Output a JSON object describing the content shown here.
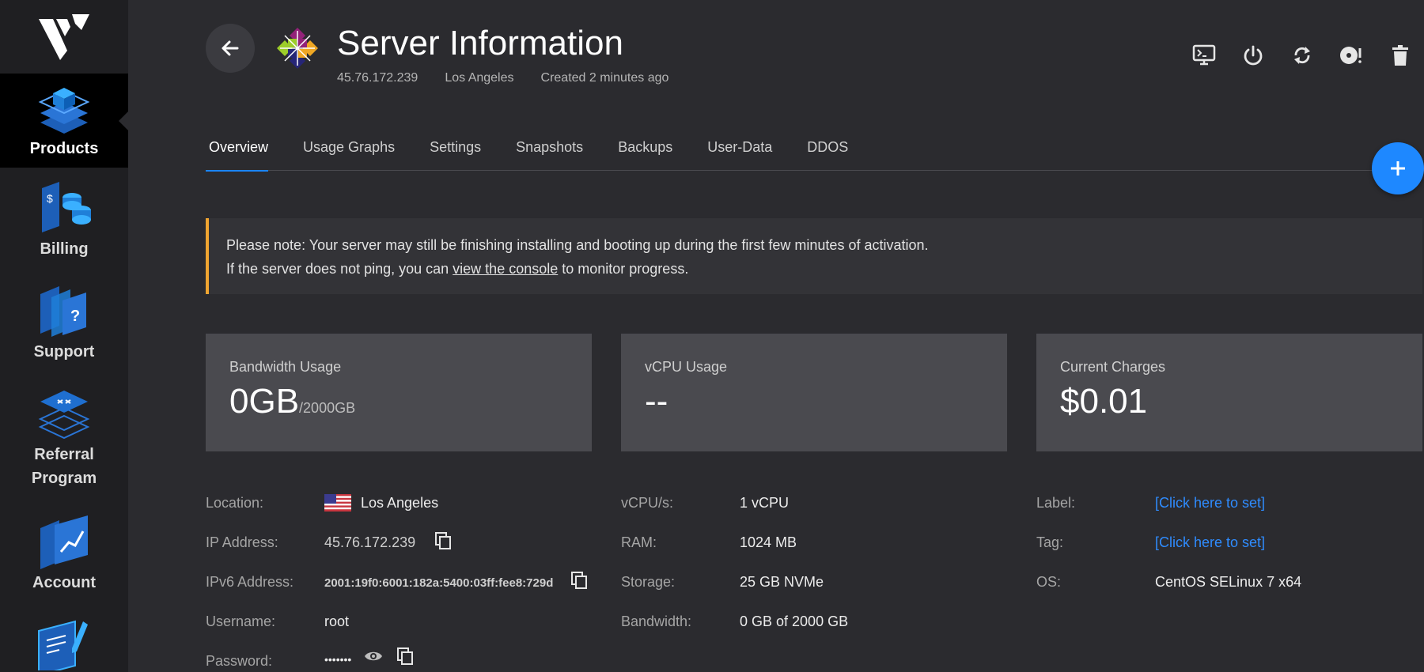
{
  "sidebar": {
    "logo": "vultr-logo",
    "items": [
      {
        "label": "Products",
        "icon": "products-icon",
        "active": true
      },
      {
        "label": "Billing",
        "icon": "billing-icon"
      },
      {
        "label": "Support",
        "icon": "support-icon"
      },
      {
        "label": "Referral Program",
        "icon": "referral-icon"
      },
      {
        "label": "Account",
        "icon": "account-icon"
      },
      {
        "label": "",
        "icon": "documentation-icon"
      }
    ]
  },
  "header": {
    "title": "Server Information",
    "ip": "45.76.172.239",
    "location": "Los Angeles",
    "created": "Created 2 minutes ago",
    "actions": [
      "console-icon",
      "power-icon",
      "restart-icon",
      "reinstall-icon",
      "delete-icon"
    ]
  },
  "tabs": [
    "Overview",
    "Usage Graphs",
    "Settings",
    "Snapshots",
    "Backups",
    "User-Data",
    "DDOS"
  ],
  "notice": {
    "line1": "Please note: Your server may still be finishing installing and booting up during the first few minutes of activation.",
    "line2_before": "If the server does not ping, you can ",
    "line2_link": "view the console",
    "line2_after": " to monitor progress.",
    "accent_color": "#f0a531"
  },
  "cards": {
    "bandwidth": {
      "title": "Bandwidth Usage",
      "value": "0GB",
      "sub": "/2000GB"
    },
    "vcpu": {
      "title": "vCPU Usage",
      "value": "--"
    },
    "charges": {
      "title": "Current Charges",
      "value": "$0.01"
    }
  },
  "info": {
    "location_label": "Location:",
    "location_value": "Los Angeles",
    "ip_label": "IP Address:",
    "ip_value": "45.76.172.239",
    "ipv6_label": "IPv6 Address:",
    "ipv6_value": "2001:19f0:6001:182a:5400:03ff:fee8:729d",
    "username_label": "Username:",
    "username_value": "root",
    "password_label": "Password:",
    "password_value": "•••••••",
    "vcpus_label": "vCPU/s:",
    "vcpus_value": "1 vCPU",
    "ram_label": "RAM:",
    "ram_value": "1024 MB",
    "storage_label": "Storage:",
    "storage_value": "25 GB NVMe",
    "bandwidth_label": "Bandwidth:",
    "bandwidth_value": "0 GB of 2000 GB",
    "label_label": "Label:",
    "label_value": "[Click here to set]",
    "tag_label": "Tag:",
    "tag_value": "[Click here to set]",
    "os_label": "OS:",
    "os_value": "CentOS SELinux 7 x64"
  },
  "colors": {
    "accent": "#1e88ff",
    "link": "#2f8cff",
    "background": "#2b2b2f",
    "sidebar": "#1f1f22"
  }
}
